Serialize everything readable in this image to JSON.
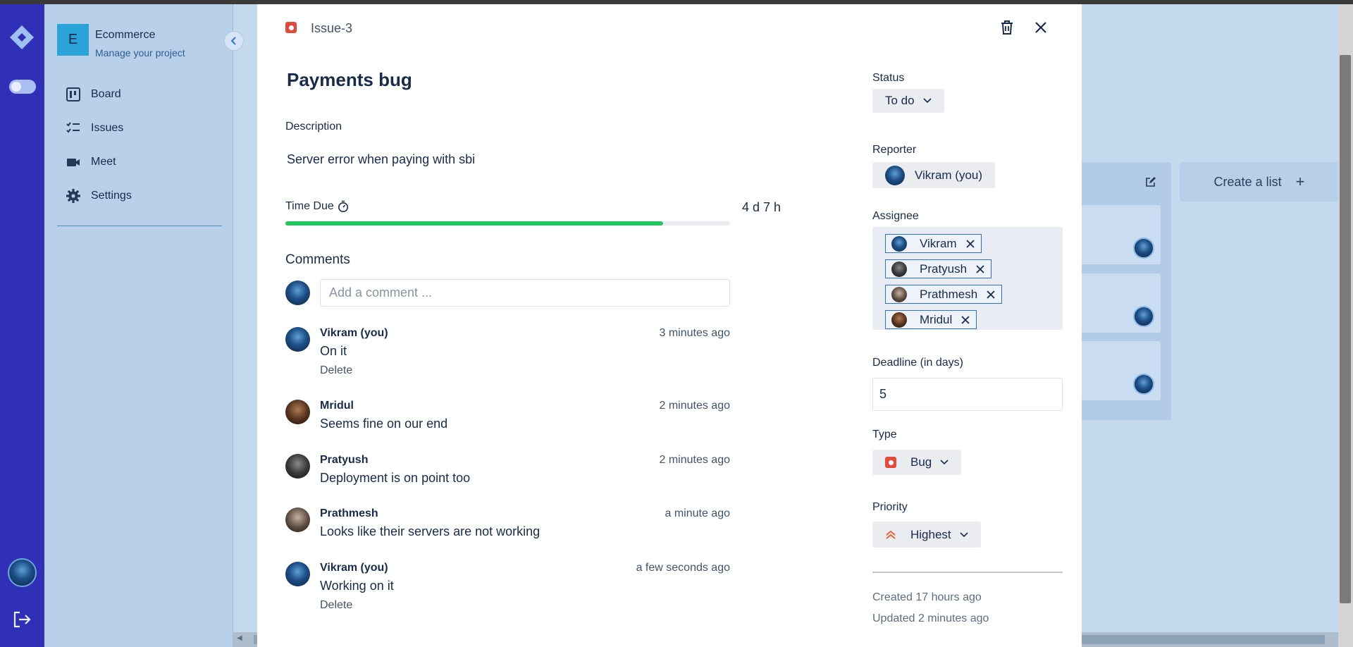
{
  "project": {
    "avatar_letter": "E",
    "name": "Ecommerce",
    "subtitle": "Manage your project"
  },
  "sidebar": {
    "items": [
      {
        "label": "Board",
        "icon": "board-icon"
      },
      {
        "label": "Issues",
        "icon": "issues-icon"
      },
      {
        "label": "Meet",
        "icon": "video-icon"
      },
      {
        "label": "Settings",
        "icon": "gear-icon"
      }
    ]
  },
  "board": {
    "create_list_label": "Create a list"
  },
  "issue": {
    "key": "Issue-3",
    "title": "Payments bug",
    "description_label": "Description",
    "description": "Server error when paying with sbi",
    "time_due_label": "Time Due",
    "time_due_value": "4 d 7 h",
    "time_due_progress": 0.85,
    "comments_label": "Comments",
    "comment_placeholder": "Add a comment ...",
    "comments": [
      {
        "author": "Vikram (you)",
        "time": "3 minutes ago",
        "text": "On it",
        "delete_label": "Delete"
      },
      {
        "author": "Mridul",
        "time": "2 minutes ago",
        "text": "Seems fine on our end"
      },
      {
        "author": "Pratyush",
        "time": "2 minutes ago",
        "text": "Deployment is on point too"
      },
      {
        "author": "Prathmesh",
        "time": "a minute ago",
        "text": "Looks like their servers are not working"
      },
      {
        "author": "Vikram (you)",
        "time": "a few seconds ago",
        "text": "Working on it",
        "delete_label": "Delete"
      }
    ]
  },
  "details": {
    "status_label": "Status",
    "status_value": "To do",
    "reporter_label": "Reporter",
    "reporter_value": "Vikram (you)",
    "assignee_label": "Assignee",
    "assignees": [
      "Vikram",
      "Pratyush",
      "Prathmesh",
      "Mridul"
    ],
    "deadline_label": "Deadline (in days)",
    "deadline_value": "5",
    "type_label": "Type",
    "type_value": "Bug",
    "priority_label": "Priority",
    "priority_value": "Highest",
    "created": "Created 17 hours ago",
    "updated": "Updated 2 minutes ago"
  },
  "colors": {
    "rail": "#2f2fb8",
    "sidebar": "#b8d0ea",
    "progress": "#22c55e",
    "bug": "#e5493a",
    "priority": "#e8653b",
    "tag_border": "#2d6fd6"
  }
}
